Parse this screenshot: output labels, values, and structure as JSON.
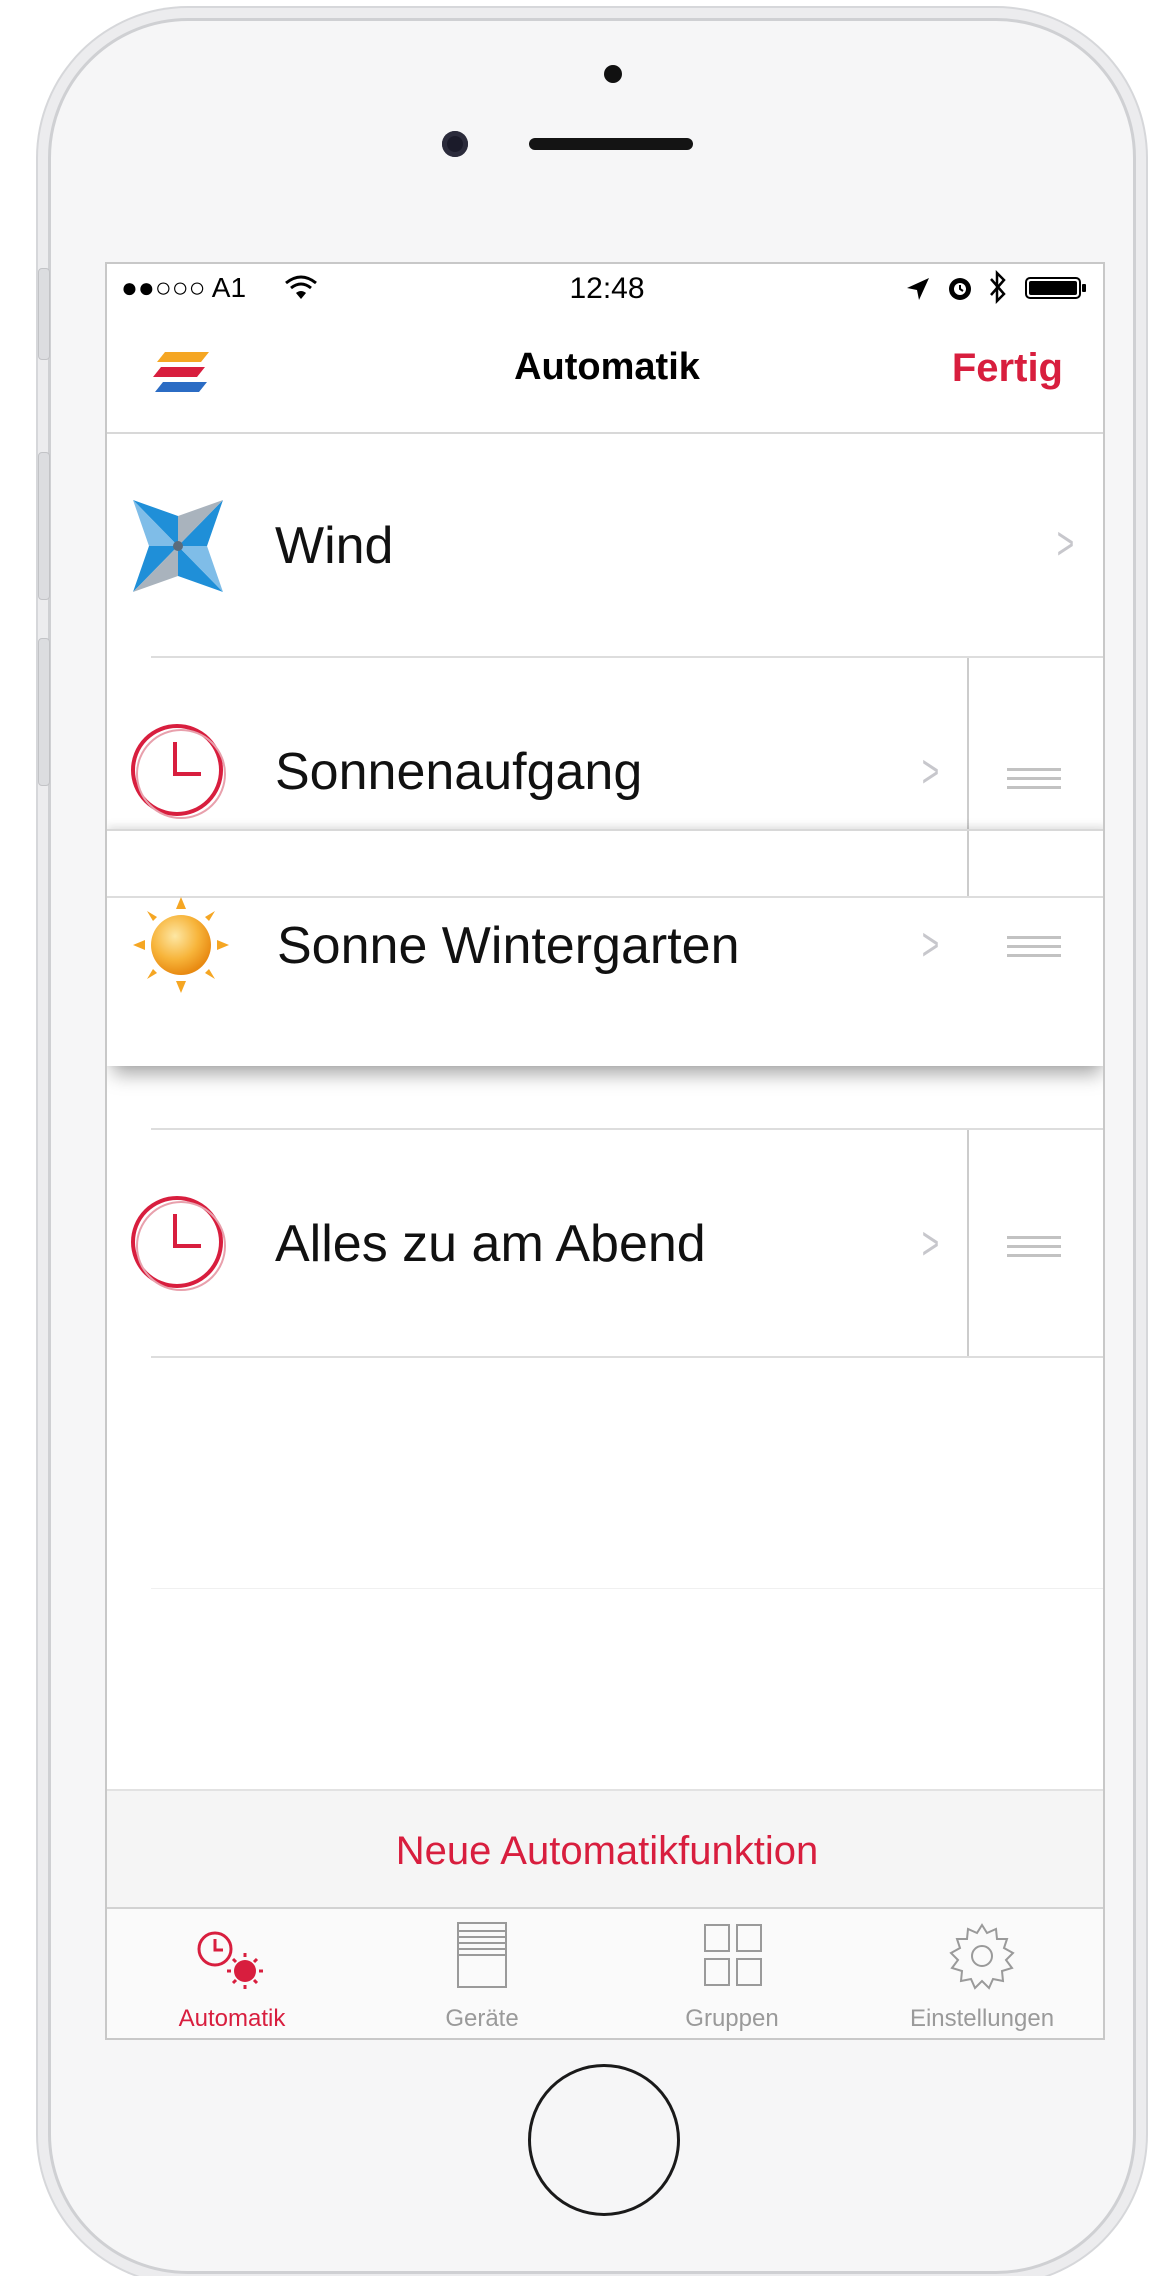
{
  "status_bar": {
    "carrier": "●●○○○ A1",
    "time": "12:48"
  },
  "nav": {
    "title": "Automatik",
    "done_label": "Fertig"
  },
  "rows": [
    {
      "label": "Wind",
      "icon": "pinwheel-icon"
    },
    {
      "label": "Sonnenaufgang",
      "icon": "clock-icon"
    },
    {
      "label": "Sonne Wintergarten",
      "icon": "sun-icon"
    },
    {
      "label": "Alles zu am Abend",
      "icon": "clock-icon"
    }
  ],
  "action_label": "Neue Automatikfunktion",
  "tabs": [
    {
      "label": "Automatik",
      "icon": "clock-sun-icon",
      "active": true
    },
    {
      "label": "Geräte",
      "icon": "blinds-icon",
      "active": false
    },
    {
      "label": "Gruppen",
      "icon": "grid-icon",
      "active": false
    },
    {
      "label": "Einstellungen",
      "icon": "gear-icon",
      "active": false
    }
  ],
  "colors": {
    "accent": "#d81e3e",
    "inactive_tab": "#9a9a9a",
    "separator": "#dddddd"
  }
}
